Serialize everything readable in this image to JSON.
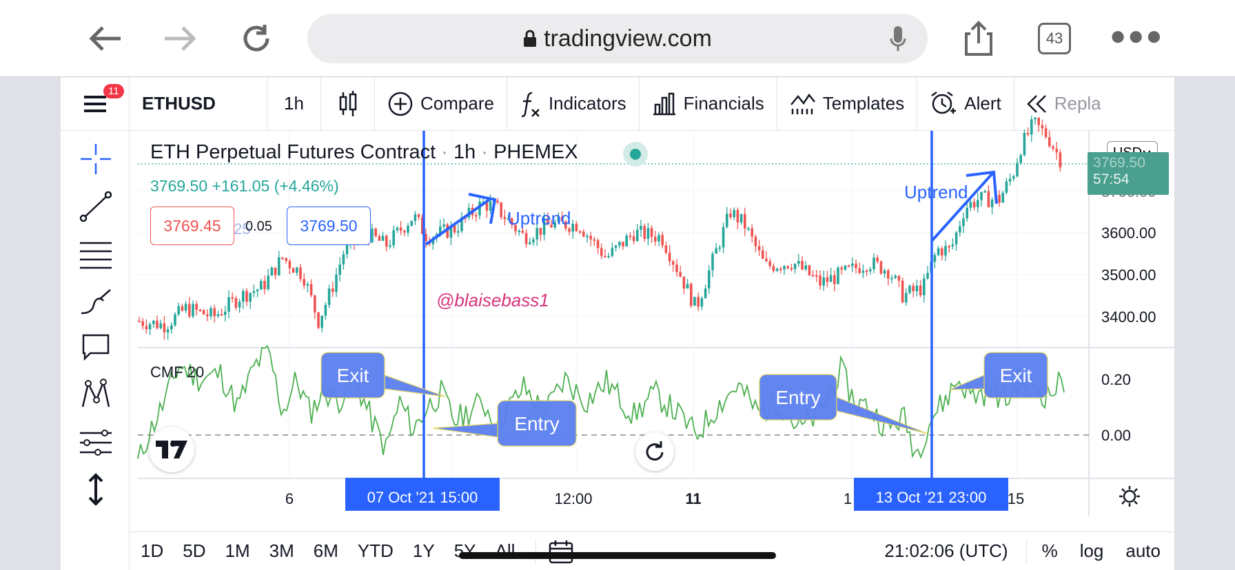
{
  "browser": {
    "url": "tradingview.com",
    "tab_count": "43"
  },
  "toolbar": {
    "menu_badge": "11",
    "symbol": "ETHUSD",
    "interval": "1h",
    "compare": "Compare",
    "indicators": "Indicators",
    "financials": "Financials",
    "templates": "Templates",
    "alert": "Alert",
    "replay": "Repla"
  },
  "legend": {
    "title": "ETH Perpetual Futures Contract",
    "interval": "1h",
    "exchange": "PHEMEX",
    "ohlc": "3769.50 +161.05 (+4.46%)",
    "sell": "3769.45",
    "spread": "0.05",
    "buy": "3769.50",
    "faded": "ol25"
  },
  "price_axis": {
    "labels": [
      "3600.00",
      "3500.00",
      "3400.00"
    ],
    "currency": "USD",
    "price_tag": "3769.50",
    "countdown": "57:54"
  },
  "cmf": {
    "label": "CMF 20",
    "labels": [
      "0.20",
      "0.00"
    ]
  },
  "time_axis": {
    "labels": [
      "6",
      "12:00",
      "11",
      "1",
      "15"
    ],
    "cursor_left": "07 Oct '21   15:00",
    "cursor_right": "13 Oct '21   23:00"
  },
  "annotations": {
    "uptrend_1": "Uptrend",
    "uptrend_2": "Uptrend",
    "watermark": "@blaisebass1",
    "exit_1": "Exit",
    "entry_1": "Entry",
    "entry_2": "Entry",
    "exit_2": "Exit"
  },
  "bottom": {
    "ranges": [
      "1D",
      "5D",
      "1M",
      "3M",
      "6M",
      "YTD",
      "1Y",
      "5Y",
      "All"
    ],
    "clock": "21:02:06 (UTC)",
    "percent": "%",
    "log": "log",
    "auto": "auto"
  },
  "colors": {
    "up": "#26a69a",
    "down": "#ef5350",
    "accent": "#2962ff",
    "cmf": "#4caf50",
    "callout": "#5b7ff0"
  }
}
